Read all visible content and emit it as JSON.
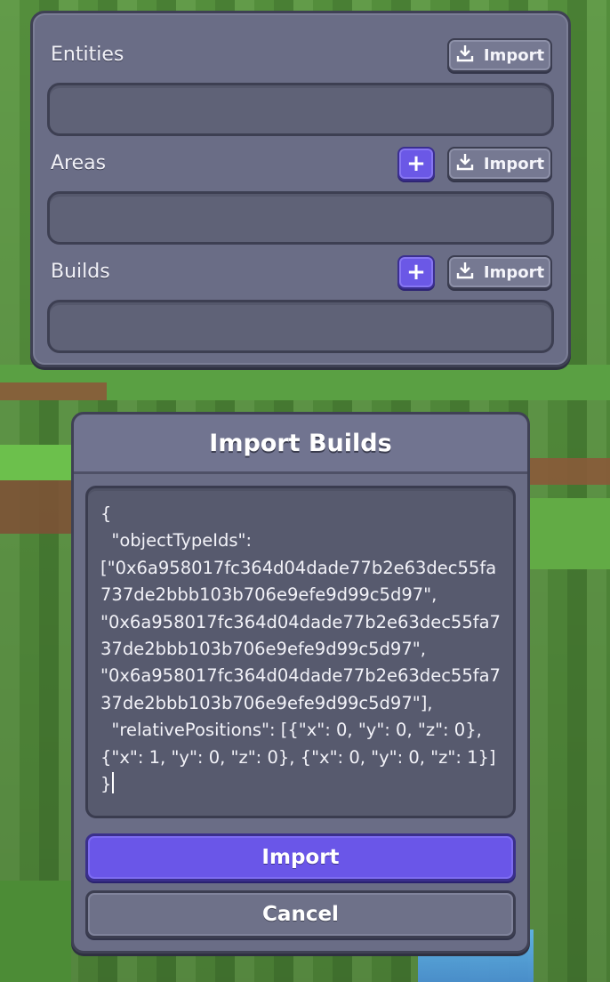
{
  "panel": {
    "sections": [
      {
        "label": "Entities",
        "import_label": "Import",
        "has_add": false
      },
      {
        "label": "Areas",
        "import_label": "Import",
        "has_add": true,
        "add_label": "+"
      },
      {
        "label": "Builds",
        "import_label": "Import",
        "has_add": true,
        "add_label": "+"
      }
    ]
  },
  "modal": {
    "title": "Import Builds",
    "textarea_value": "{\n  \"objectTypeIds\":\n[\"0x6a958017fc364d04dade77b2e63dec55fa737de2bbb103b706e9efe9d99c5d97\",\n\"0x6a958017fc364d04dade77b2e63dec55fa737de2bbb103b706e9efe9d99c5d97\",\n\"0x6a958017fc364d04dade77b2e63dec55fa737de2bbb103b706e9efe9d99c5d97\"],\n  \"relativePositions\": [{\"x\": 0, \"y\": 0, \"z\": 0},\n{\"x\": 1, \"y\": 0, \"z\": 0}, {\"x\": 0, \"y\": 0, \"z\": 1}]\n}",
    "import_button": "Import",
    "cancel_button": "Cancel"
  },
  "icons": {
    "import": "download-icon",
    "add": "plus-icon",
    "resize": "resize-handle-icon"
  },
  "colors": {
    "panel_bg": "#6a6d86",
    "primary": "#6a56e8",
    "grass": "#5b9a41"
  }
}
